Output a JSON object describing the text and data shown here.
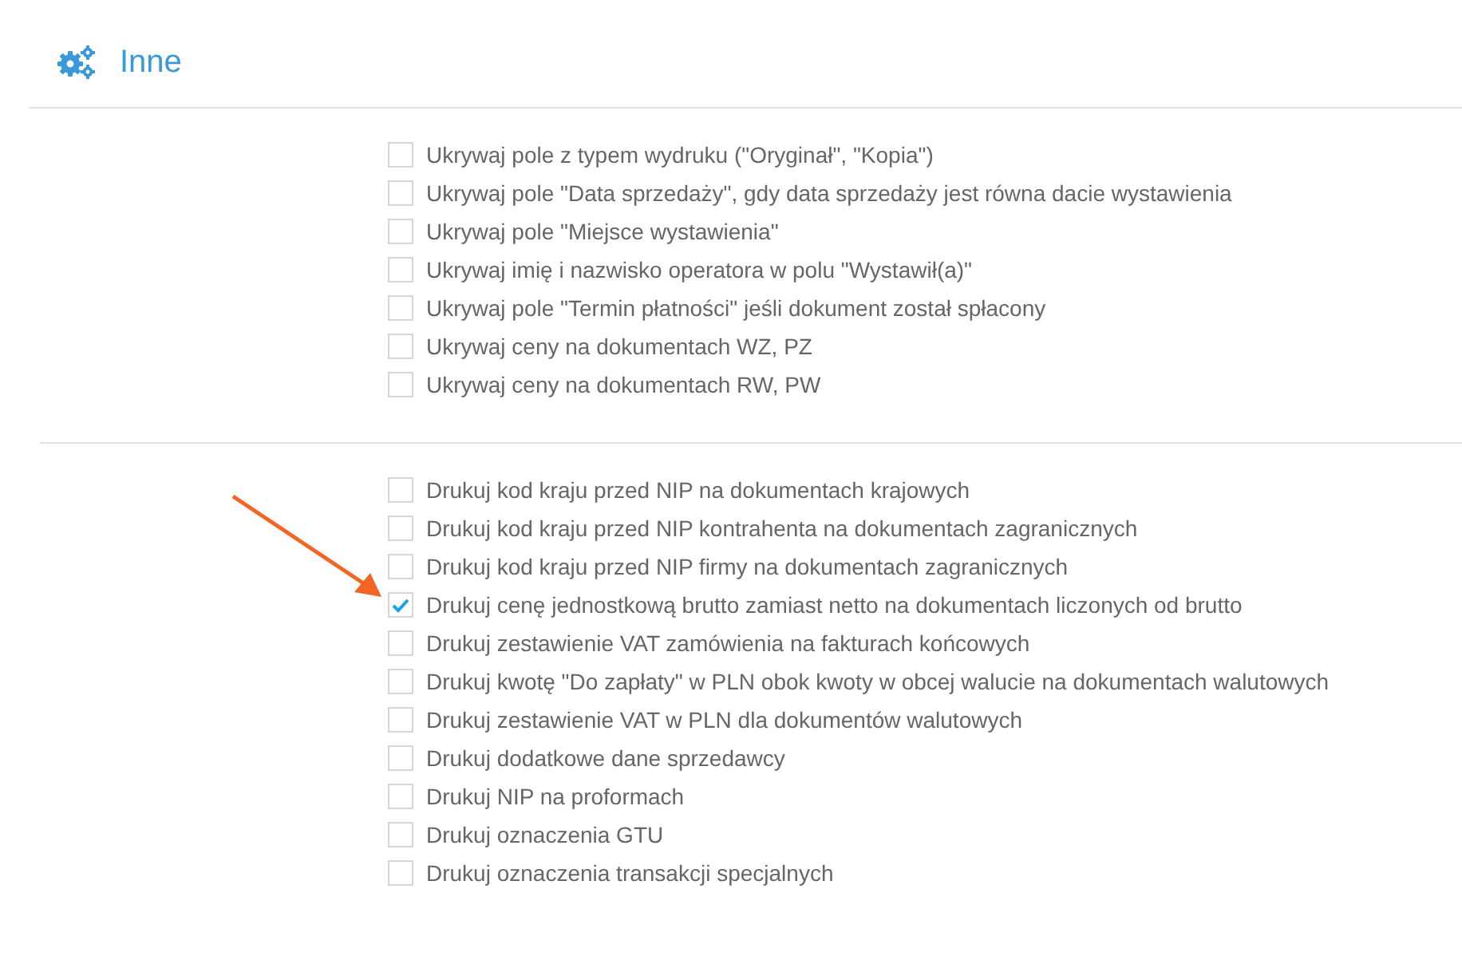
{
  "section": {
    "title": "Inne"
  },
  "groups": [
    {
      "options": [
        {
          "label": "Ukrywaj pole z typem wydruku (\"Oryginał\", \"Kopia\")",
          "checked": false
        },
        {
          "label": "Ukrywaj pole \"Data sprzedaży\", gdy data sprzedaży jest równa dacie wystawienia",
          "checked": false
        },
        {
          "label": "Ukrywaj pole \"Miejsce wystawienia\"",
          "checked": false
        },
        {
          "label": "Ukrywaj imię i nazwisko operatora w polu \"Wystawił(a)\"",
          "checked": false
        },
        {
          "label": "Ukrywaj pole \"Termin płatności\" jeśli dokument został spłacony",
          "checked": false
        },
        {
          "label": "Ukrywaj ceny na dokumentach WZ, PZ",
          "checked": false
        },
        {
          "label": "Ukrywaj ceny na dokumentach RW, PW",
          "checked": false
        }
      ]
    },
    {
      "options": [
        {
          "label": "Drukuj kod kraju przed NIP na dokumentach krajowych",
          "checked": false
        },
        {
          "label": "Drukuj kod kraju przed NIP kontrahenta na dokumentach zagranicznych",
          "checked": false
        },
        {
          "label": "Drukuj kod kraju przed NIP firmy na dokumentach zagranicznych",
          "checked": false
        },
        {
          "label": "Drukuj cenę jednostkową brutto zamiast netto na dokumentach liczonych od brutto",
          "checked": true
        },
        {
          "label": "Drukuj zestawienie VAT zamówienia na fakturach końcowych",
          "checked": false
        },
        {
          "label": "Drukuj kwotę \"Do zapłaty\" w PLN obok kwoty w obcej walucie na dokumentach walutowych",
          "checked": false
        },
        {
          "label": "Drukuj zestawienie VAT w PLN dla dokumentów walutowych",
          "checked": false
        },
        {
          "label": "Drukuj dodatkowe dane sprzedawcy",
          "checked": false
        },
        {
          "label": "Drukuj NIP na proformach",
          "checked": false
        },
        {
          "label": "Drukuj oznaczenia GTU",
          "checked": false
        },
        {
          "label": "Drukuj oznaczenia transakcji specjalnych",
          "checked": false
        }
      ]
    }
  ]
}
